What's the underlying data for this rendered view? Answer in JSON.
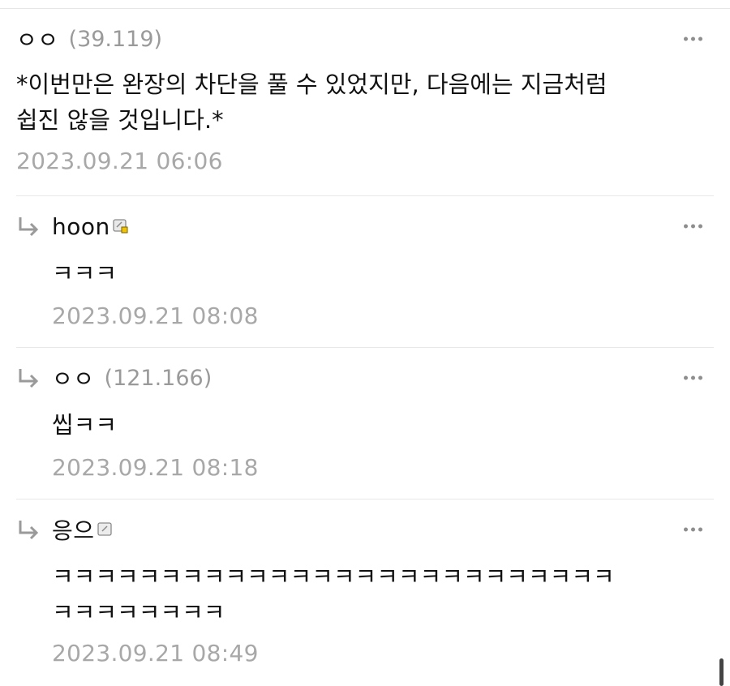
{
  "comments": [
    {
      "author": "ㅇㅇ",
      "ip": "(39.119)",
      "text": "*이번만은 완장의 차단을 풀 수 있었지만, 다음에는 지금처럼\n쉽진 않을 것입니다.*",
      "date": "2023.09.21 06:06"
    }
  ],
  "replies": [
    {
      "author": "hoon",
      "ip": "",
      "text": "ㅋㅋㅋ",
      "date": "2023.09.21 08:08",
      "badge": "fixed-nick-badge-yellow"
    },
    {
      "author": "ㅇㅇ",
      "ip": "(121.166)",
      "text": "씹ㅋㅋ",
      "date": "2023.09.21 08:18"
    },
    {
      "author": "응으",
      "ip": "",
      "text": "ㅋㅋㅋㅋㅋㅋㅋㅋㅋㅋㅋㅋㅋㅋㅋㅋㅋㅋㅋㅋㅋㅋㅋㅋㅋㅋ\nㅋㅋㅋㅋㅋㅋㅋㅋ",
      "date": "2023.09.21 08:49",
      "badge": "half-nick-badge-gray"
    }
  ],
  "colors": {
    "text": "#111111",
    "meta": "#a8a8a8",
    "divider": "#e8e8e8"
  }
}
